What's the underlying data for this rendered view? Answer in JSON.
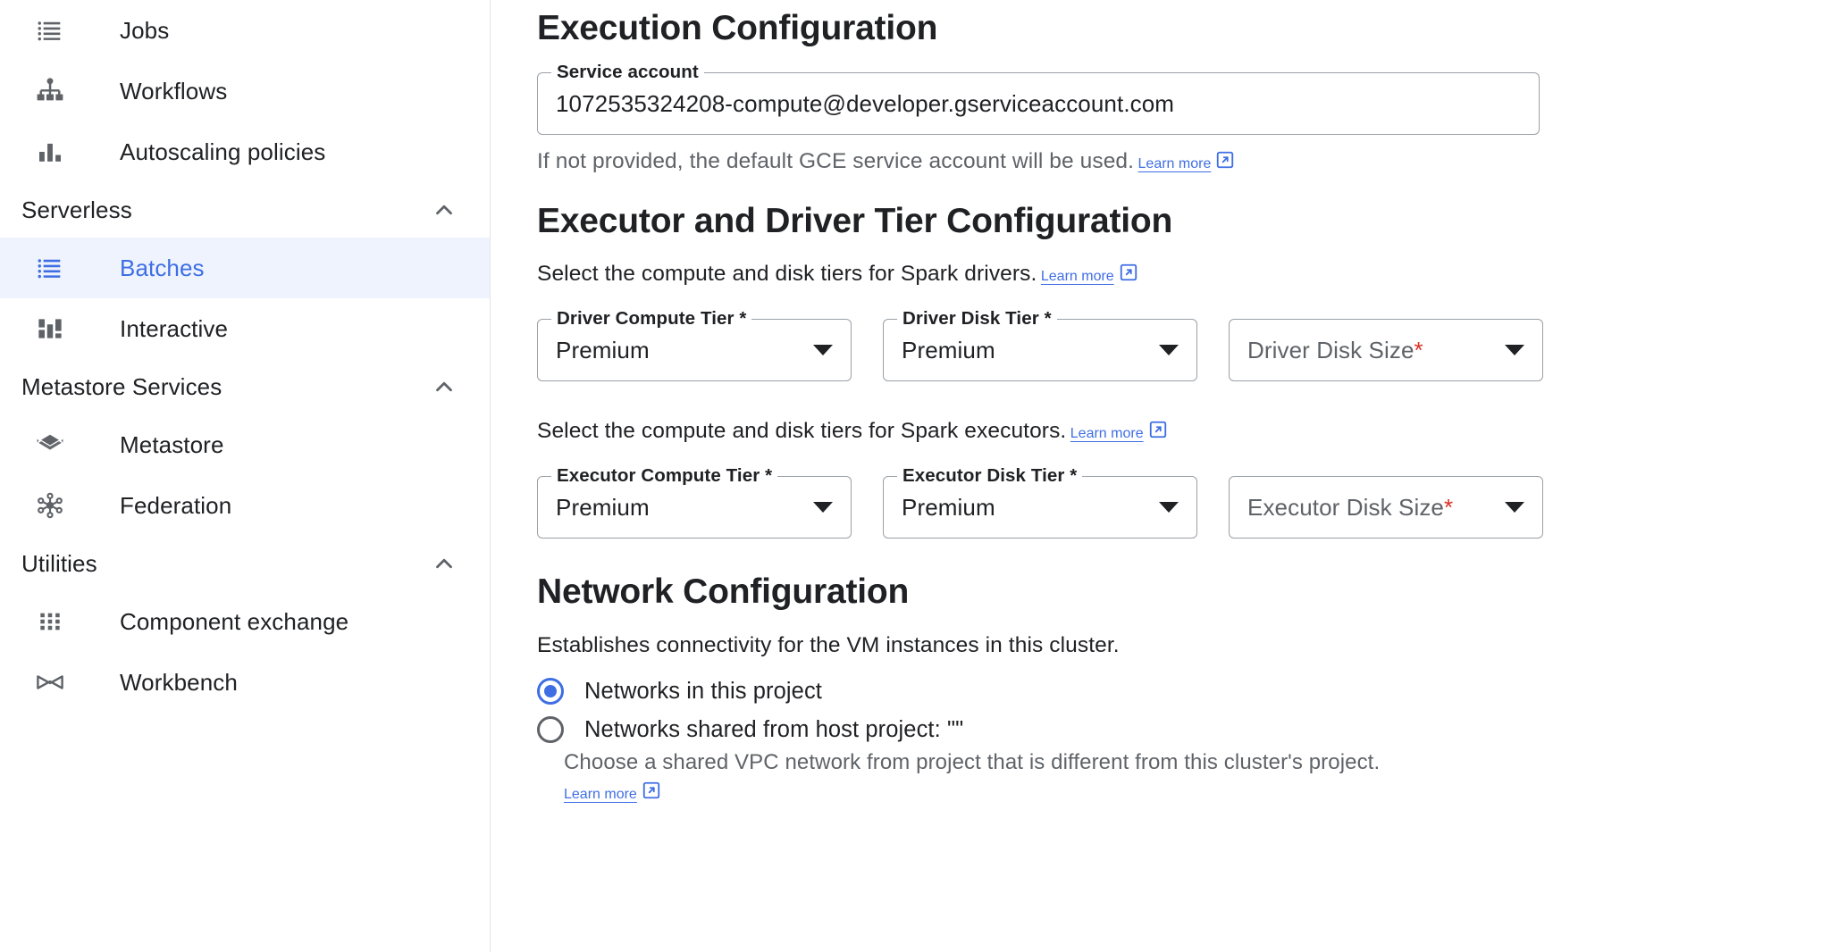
{
  "sidebar": {
    "items": [
      {
        "type": "item",
        "label": "Jobs",
        "icon": "list-icon",
        "selected": false
      },
      {
        "type": "item",
        "label": "Workflows",
        "icon": "workflow-hierarchy-icon",
        "selected": false
      },
      {
        "type": "item",
        "label": "Autoscaling policies",
        "icon": "bar-chart-icon",
        "selected": false
      },
      {
        "type": "section",
        "label": "Serverless",
        "icon": "chevron-up-icon",
        "expanded": true
      },
      {
        "type": "item",
        "label": "Batches",
        "icon": "list-icon",
        "selected": true
      },
      {
        "type": "item",
        "label": "Interactive",
        "icon": "dashboard-blocks-icon",
        "selected": false
      },
      {
        "type": "section",
        "label": "Metastore Services",
        "icon": "chevron-up-icon",
        "expanded": true
      },
      {
        "type": "item",
        "label": "Metastore",
        "icon": "layers-icon",
        "selected": false
      },
      {
        "type": "item",
        "label": "Federation",
        "icon": "hub-network-icon",
        "selected": false
      },
      {
        "type": "section",
        "label": "Utilities",
        "icon": "chevron-up-icon",
        "expanded": true
      },
      {
        "type": "item",
        "label": "Component exchange",
        "icon": "grid-dots-icon",
        "selected": false
      },
      {
        "type": "item",
        "label": "Workbench",
        "icon": "workbench-icon",
        "selected": false
      }
    ]
  },
  "execution": {
    "title": "Execution Configuration",
    "service_account": {
      "legend": "Service account",
      "value": "1072535324208-compute@developer.gserviceaccount.com",
      "placeholder": "Service account"
    },
    "hint_text": "If not provided, the default GCE service account will be used.",
    "learn_more": "Learn more"
  },
  "tiers": {
    "title": "Executor and Driver Tier Configuration",
    "driver_desc": "Select the compute and disk tiers for Spark drivers.",
    "driver_learn_more": "Learn more",
    "executor_desc": "Select the compute and disk tiers for Spark executors.",
    "executor_learn_more": "Learn more",
    "driver": [
      {
        "legend": "Driver Compute Tier *",
        "value": "Premium",
        "is_placeholder": false
      },
      {
        "legend": "Driver Disk Tier *",
        "value": "Premium",
        "is_placeholder": false
      },
      {
        "legend": "",
        "value": "Driver Disk Size",
        "required_star": "*",
        "is_placeholder": true
      }
    ],
    "executor": [
      {
        "legend": "Executor Compute Tier *",
        "value": "Premium",
        "is_placeholder": false
      },
      {
        "legend": "Executor Disk Tier *",
        "value": "Premium",
        "is_placeholder": false
      },
      {
        "legend": "",
        "value": "Executor Disk Size",
        "required_star": "*",
        "is_placeholder": true
      }
    ]
  },
  "network": {
    "title": "Network Configuration",
    "description": "Establishes connectivity for the VM instances in this cluster.",
    "options": [
      {
        "label": "Networks in this project",
        "checked": true
      },
      {
        "label": "Networks shared from host project: \"\"",
        "checked": false
      }
    ],
    "shared_note": "Choose a shared VPC network from project that is different from this cluster's project.",
    "shared_learn_more": "Learn more"
  },
  "colors": {
    "accent": "#3f6ee4",
    "selected_bg": "#eef3fd",
    "required_star": "#d93025",
    "text_primary": "#202124",
    "text_secondary": "#5f6368",
    "border": "#9aa0a6"
  }
}
